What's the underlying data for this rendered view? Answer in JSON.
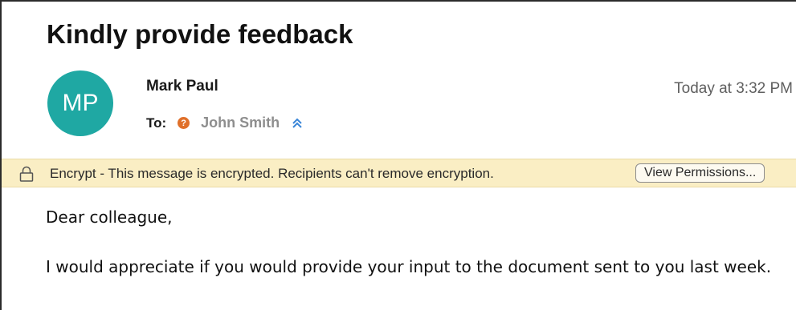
{
  "email": {
    "subject": "Kindly provide feedback",
    "sender": {
      "initials": "MP",
      "name": "Mark Paul",
      "avatar_color": "#1fa8a3"
    },
    "timestamp": "Today at 3:32 PM",
    "to_label": "To:",
    "recipients": [
      {
        "name": "John Smith",
        "status_icon": "unknown-contact-icon",
        "status_color": "#e0702a"
      }
    ],
    "expand_icon": "chevron-up-double-icon"
  },
  "encryption_banner": {
    "icon": "lock-icon",
    "text": "Encrypt - This message is encrypted. Recipients can't remove encryption.",
    "button_label": "View Permissions...",
    "background_color": "#faeec4"
  },
  "body": {
    "greeting": "Dear colleague,",
    "paragraph": "I would appreciate if you would provide your input to the document sent to you last week."
  }
}
